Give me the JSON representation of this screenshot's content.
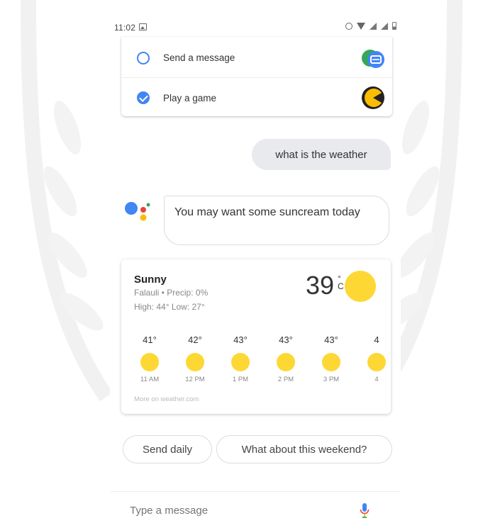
{
  "status_bar": {
    "time": "11:02"
  },
  "choices": [
    {
      "label": "Send a message",
      "checked": false,
      "icon": "messages-app-icon"
    },
    {
      "label": "Play a game",
      "checked": true,
      "icon": "pacman-game-icon"
    }
  ],
  "conversation": {
    "user_message": "what is the weather",
    "assistant_message": "You may want some suncream today"
  },
  "weather": {
    "condition": "Sunny",
    "location_precip": "Falauli • Precip: 0%",
    "high_low": "High: 44° Low: 27°",
    "temperature": "39",
    "unit_top": "°",
    "unit_bottom": "C",
    "hourly": [
      {
        "temp": "41°",
        "time": "11 AM"
      },
      {
        "temp": "42°",
        "time": "12 PM"
      },
      {
        "temp": "43°",
        "time": "1 PM"
      },
      {
        "temp": "43°",
        "time": "2 PM"
      },
      {
        "temp": "43°",
        "time": "3 PM"
      },
      {
        "temp": "4",
        "time": "4"
      }
    ],
    "source": "More on weather.com"
  },
  "suggestions": [
    "Send daily",
    "What about this weekend?"
  ],
  "composer": {
    "placeholder": "Type a message"
  },
  "colors": {
    "accent_blue": "#4285f4",
    "sun_yellow": "#fdd835",
    "assistant_red": "#ea4335",
    "assistant_yellow": "#fbbc05",
    "assistant_green": "#34a853"
  }
}
